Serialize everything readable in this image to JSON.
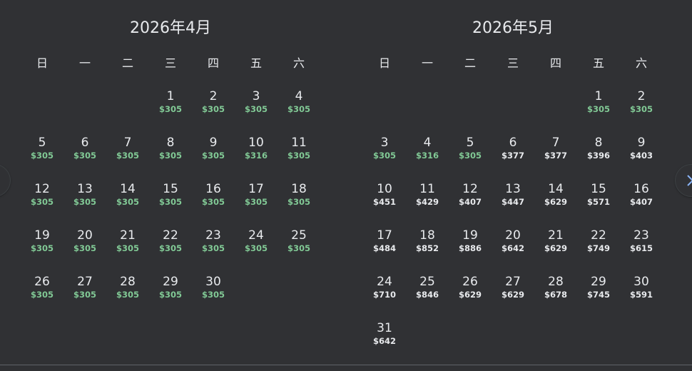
{
  "colors": {
    "background": "#303134",
    "text": "#e8eaed",
    "low_price": "#81c995"
  },
  "nav": {
    "prev_icon": "chevron-left-icon",
    "next_icon": "chevron-right-icon"
  },
  "months": [
    {
      "title": "2026年4月",
      "weekdays": [
        "日",
        "一",
        "二",
        "三",
        "四",
        "五",
        "六"
      ],
      "first_weekday": 3,
      "days": [
        {
          "day": "1",
          "price": "$305",
          "low": true
        },
        {
          "day": "2",
          "price": "$305",
          "low": true
        },
        {
          "day": "3",
          "price": "$305",
          "low": true
        },
        {
          "day": "4",
          "price": "$305",
          "low": true
        },
        {
          "day": "5",
          "price": "$305",
          "low": true
        },
        {
          "day": "6",
          "price": "$305",
          "low": true
        },
        {
          "day": "7",
          "price": "$305",
          "low": true
        },
        {
          "day": "8",
          "price": "$305",
          "low": true
        },
        {
          "day": "9",
          "price": "$305",
          "low": true
        },
        {
          "day": "10",
          "price": "$316",
          "low": true
        },
        {
          "day": "11",
          "price": "$305",
          "low": true
        },
        {
          "day": "12",
          "price": "$305",
          "low": true
        },
        {
          "day": "13",
          "price": "$305",
          "low": true
        },
        {
          "day": "14",
          "price": "$305",
          "low": true
        },
        {
          "day": "15",
          "price": "$305",
          "low": true
        },
        {
          "day": "16",
          "price": "$305",
          "low": true
        },
        {
          "day": "17",
          "price": "$305",
          "low": true
        },
        {
          "day": "18",
          "price": "$305",
          "low": true
        },
        {
          "day": "19",
          "price": "$305",
          "low": true
        },
        {
          "day": "20",
          "price": "$305",
          "low": true
        },
        {
          "day": "21",
          "price": "$305",
          "low": true
        },
        {
          "day": "22",
          "price": "$305",
          "low": true
        },
        {
          "day": "23",
          "price": "$305",
          "low": true
        },
        {
          "day": "24",
          "price": "$305",
          "low": true
        },
        {
          "day": "25",
          "price": "$305",
          "low": true
        },
        {
          "day": "26",
          "price": "$305",
          "low": true
        },
        {
          "day": "27",
          "price": "$305",
          "low": true
        },
        {
          "day": "28",
          "price": "$305",
          "low": true
        },
        {
          "day": "29",
          "price": "$305",
          "low": true
        },
        {
          "day": "30",
          "price": "$305",
          "low": true
        }
      ]
    },
    {
      "title": "2026年5月",
      "weekdays": [
        "日",
        "一",
        "二",
        "三",
        "四",
        "五",
        "六"
      ],
      "first_weekday": 5,
      "days": [
        {
          "day": "1",
          "price": "$305",
          "low": true
        },
        {
          "day": "2",
          "price": "$305",
          "low": true
        },
        {
          "day": "3",
          "price": "$305",
          "low": true
        },
        {
          "day": "4",
          "price": "$316",
          "low": true
        },
        {
          "day": "5",
          "price": "$305",
          "low": true
        },
        {
          "day": "6",
          "price": "$377",
          "low": false
        },
        {
          "day": "7",
          "price": "$377",
          "low": false
        },
        {
          "day": "8",
          "price": "$396",
          "low": false
        },
        {
          "day": "9",
          "price": "$403",
          "low": false
        },
        {
          "day": "10",
          "price": "$451",
          "low": false
        },
        {
          "day": "11",
          "price": "$429",
          "low": false
        },
        {
          "day": "12",
          "price": "$407",
          "low": false
        },
        {
          "day": "13",
          "price": "$447",
          "low": false
        },
        {
          "day": "14",
          "price": "$629",
          "low": false
        },
        {
          "day": "15",
          "price": "$571",
          "low": false
        },
        {
          "day": "16",
          "price": "$407",
          "low": false
        },
        {
          "day": "17",
          "price": "$484",
          "low": false
        },
        {
          "day": "18",
          "price": "$852",
          "low": false
        },
        {
          "day": "19",
          "price": "$886",
          "low": false
        },
        {
          "day": "20",
          "price": "$642",
          "low": false
        },
        {
          "day": "21",
          "price": "$629",
          "low": false
        },
        {
          "day": "22",
          "price": "$749",
          "low": false
        },
        {
          "day": "23",
          "price": "$615",
          "low": false
        },
        {
          "day": "24",
          "price": "$710",
          "low": false
        },
        {
          "day": "25",
          "price": "$846",
          "low": false
        },
        {
          "day": "26",
          "price": "$629",
          "low": false
        },
        {
          "day": "27",
          "price": "$629",
          "low": false
        },
        {
          "day": "28",
          "price": "$678",
          "low": false
        },
        {
          "day": "29",
          "price": "$745",
          "low": false
        },
        {
          "day": "30",
          "price": "$591",
          "low": false
        },
        {
          "day": "31",
          "price": "$642",
          "low": false
        }
      ]
    }
  ]
}
